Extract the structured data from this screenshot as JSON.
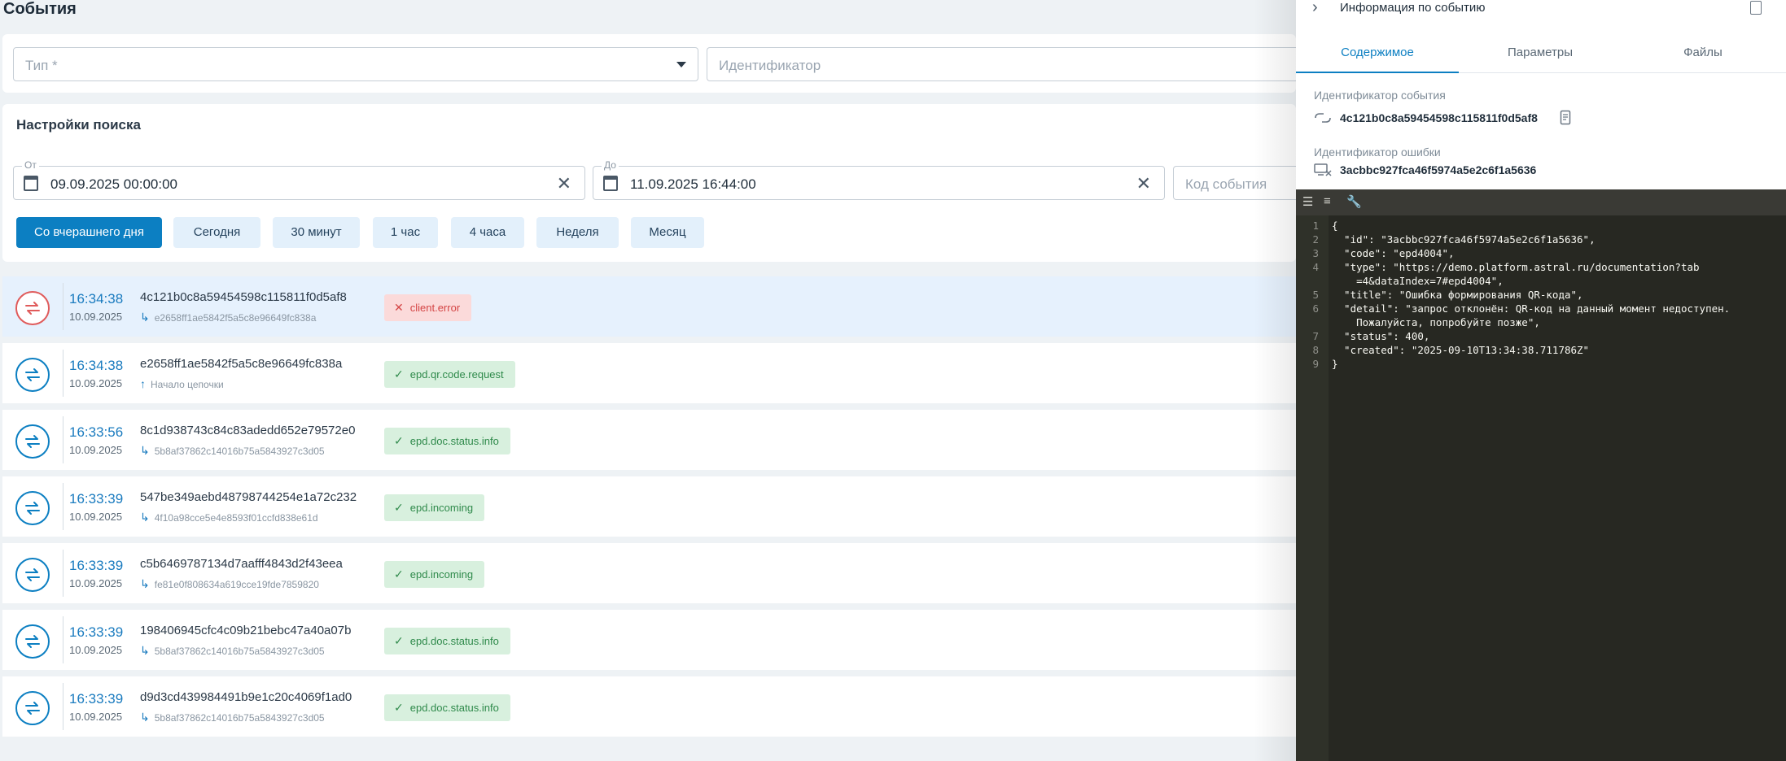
{
  "page_title": "События",
  "filters": {
    "type_placeholder": "Тип *",
    "identifier_placeholder": "Идентификатор"
  },
  "search": {
    "title": "Настройки поиска",
    "from_label": "От",
    "from_value": "09.09.2025 00:00:00",
    "to_label": "До",
    "to_value": "11.09.2025 16:44:00",
    "event_code_placeholder": "Код события",
    "periods": [
      "Со вчерашнего дня",
      "Сегодня",
      "30 минут",
      "1 час",
      "4 часа",
      "Неделя",
      "Месяц"
    ]
  },
  "events": [
    {
      "time": "16:34:38",
      "date": "10.09.2025",
      "id": "4c121b0c8a59454598c115811f0d5af8",
      "parent": "e2658ff1ae5842f5a5c8e96649fc838a",
      "badge": "client.error",
      "status": "error"
    },
    {
      "time": "16:34:38",
      "date": "10.09.2025",
      "id": "e2658ff1ae5842f5a5c8e96649fc838a",
      "parent": "Начало цепочки",
      "badge": "epd.qr.code.request",
      "status": "ok"
    },
    {
      "time": "16:33:56",
      "date": "10.09.2025",
      "id": "8c1d938743c84c83adedd652e79572e0",
      "parent": "5b8af37862c14016b75a5843927c3d05",
      "badge": "epd.doc.status.info",
      "status": "ok"
    },
    {
      "time": "16:33:39",
      "date": "10.09.2025",
      "id": "547be349aebd48798744254e1a72c232",
      "parent": "4f10a98cce5e4e8593f01ccfd838e61d",
      "badge": "epd.incoming",
      "status": "ok"
    },
    {
      "time": "16:33:39",
      "date": "10.09.2025",
      "id": "c5b6469787134d7aafff4843d2f43eea",
      "parent": "fe81e0f808634a619cce19fde7859820",
      "badge": "epd.incoming",
      "status": "ok"
    },
    {
      "time": "16:33:39",
      "date": "10.09.2025",
      "id": "198406945cfc4c09b21bebc47a40a07b",
      "parent": "5b8af37862c14016b75a5843927c3d05",
      "badge": "epd.doc.status.info",
      "status": "ok"
    },
    {
      "time": "16:33:39",
      "date": "10.09.2025",
      "id": "d9d3cd439984491b9e1c20c4069f1ad0",
      "parent": "5b8af37862c14016b75a5843927c3d05",
      "badge": "epd.doc.status.info",
      "status": "ok"
    }
  ],
  "panel": {
    "title": "Информация по событию",
    "tabs": [
      "Содержимое",
      "Параметры",
      "Файлы"
    ],
    "event_id_label": "Идентификатор события",
    "event_id": "4c121b0c8a59454598c115811f0d5af8",
    "error_id_label": "Идентификатор ошибки",
    "error_id": "3acbbc927fca46f5974a5e2c6f1a5636",
    "code": [
      {
        "n": "1",
        "t": "{"
      },
      {
        "n": "2",
        "t": "  \"id\": \"3acbbc927fca46f5974a5e2c6f1a5636\","
      },
      {
        "n": "3",
        "t": "  \"code\": \"epd4004\","
      },
      {
        "n": "4",
        "t": "  \"type\": \"https://demo.platform.astral.ru/documentation?tab\n    =4&dataIndex=7#epd4004\","
      },
      {
        "n": "5",
        "t": "  \"title\": \"Ошибка формирования QR-кода\","
      },
      {
        "n": "6",
        "t": "  \"detail\": \"запрос отклонён: QR-код на данный момент недоступен.\n    Пожалуйста, попробуйте позже\","
      },
      {
        "n": "7",
        "t": "  \"status\": 400,"
      },
      {
        "n": "8",
        "t": "  \"created\": \"2025-09-10T13:34:38.711786Z\""
      },
      {
        "n": "9",
        "t": "}"
      }
    ]
  }
}
